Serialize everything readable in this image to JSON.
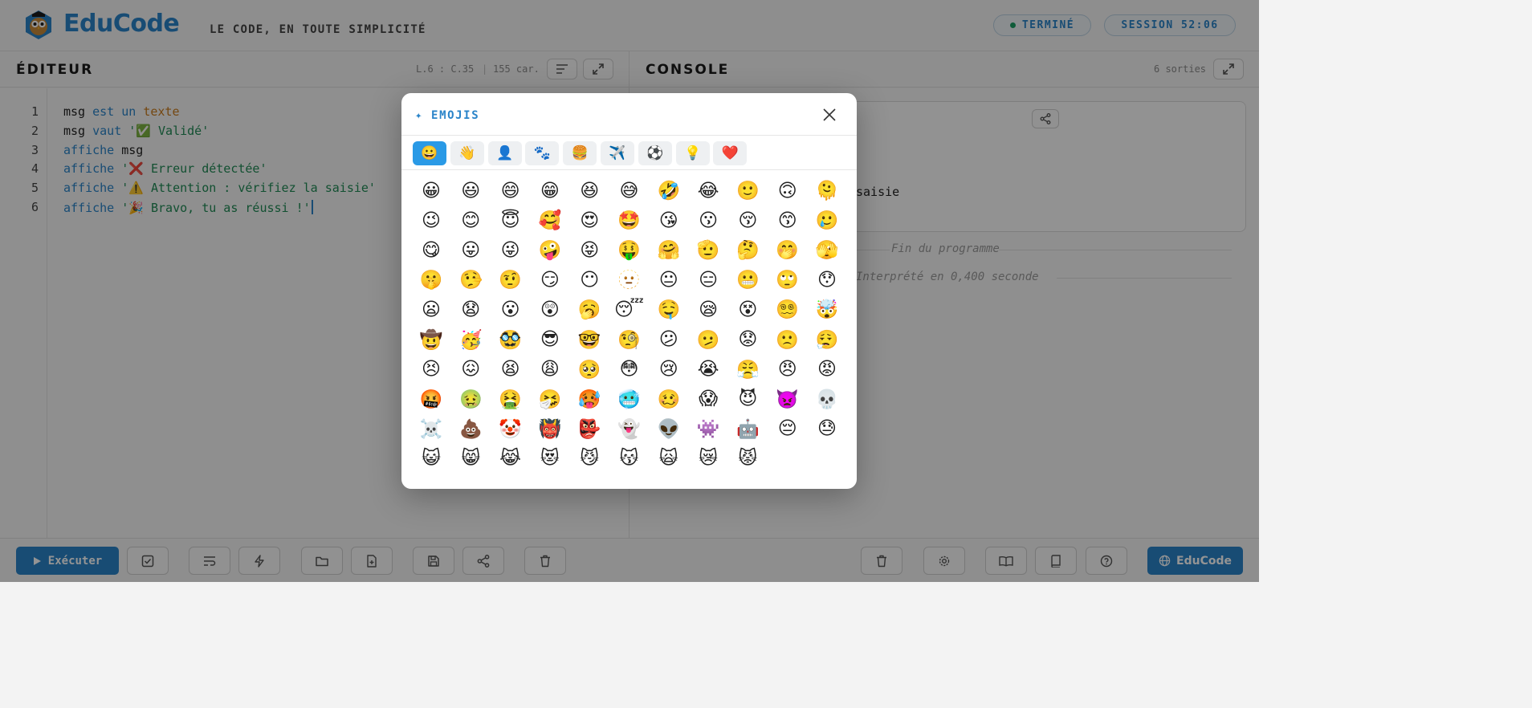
{
  "header": {
    "brand": "EduCode",
    "tagline": "LE CODE, EN TOUTE SIMPLICITÉ",
    "status": "TERMINÉ",
    "session": "SESSION 52:06"
  },
  "editor": {
    "title": "ÉDITEUR",
    "position": "L.6 : C.35",
    "sep": "|",
    "chars": "155 car.",
    "line_numbers": [
      "1",
      "2",
      "3",
      "4",
      "5",
      "6"
    ],
    "lines": [
      [
        {
          "t": "msg ",
          "c": ""
        },
        {
          "t": "est un ",
          "c": "kw"
        },
        {
          "t": "texte",
          "c": "ty"
        }
      ],
      [
        {
          "t": "msg ",
          "c": ""
        },
        {
          "t": "vaut ",
          "c": "kw"
        },
        {
          "t": "'✅ Validé'",
          "c": "str"
        }
      ],
      [
        {
          "t": "affiche ",
          "c": "kw"
        },
        {
          "t": "msg",
          "c": ""
        }
      ],
      [
        {
          "t": "affiche ",
          "c": "kw"
        },
        {
          "t": "'❌ Erreur détectée'",
          "c": "str"
        }
      ],
      [
        {
          "t": "affiche ",
          "c": "kw"
        },
        {
          "t": "'⚠️ Attention : vérifiez la saisie'",
          "c": "str"
        }
      ],
      [
        {
          "t": "affiche ",
          "c": "kw"
        },
        {
          "t": "'🎉 Bravo, tu as réussi !'",
          "c": "str"
        }
      ]
    ]
  },
  "console": {
    "title": "CONSOLE",
    "count": "6 sorties",
    "output_fragment": "saisie",
    "end_text": "Fin du programme",
    "time_text": "Interprété en 0,400 seconde"
  },
  "footer": {
    "run_label": "Exécuter",
    "brand_label": "EduCode"
  },
  "modal": {
    "title": "✦ EMOJIS",
    "categories": [
      "😀",
      "👋",
      "👤",
      "🐾",
      "🍔",
      "✈️",
      "⚽",
      "💡",
      "❤️"
    ],
    "emojis": [
      "😀",
      "😃",
      "😄",
      "😁",
      "😆",
      "😅",
      "🤣",
      "😂",
      "🙂",
      "🙃",
      "🫠",
      "😉",
      "😊",
      "😇",
      "🥰",
      "😍",
      "🤩",
      "😘",
      "😗",
      "😚",
      "😙",
      "🥲",
      "😋",
      "😛",
      "😜",
      "🤪",
      "😝",
      "🤑",
      "🤗",
      "🫡",
      "🤔",
      "🤭",
      "🫣",
      "🤫",
      "🤥",
      "🤨",
      "😏",
      "😶",
      "🫥",
      "😐",
      "😑",
      "😬",
      "🙄",
      "😯",
      "😦",
      "😧",
      "😮",
      "😲",
      "🥱",
      "😴",
      "🤤",
      "😪",
      "😵",
      "😵‍💫",
      "🤯",
      "🤠",
      "🥳",
      "🥸",
      "😎",
      "🤓",
      "🧐",
      "😕",
      "🫤",
      "😟",
      "🙁",
      "😮‍💨",
      "😣",
      "😖",
      "😫",
      "😩",
      "🥺",
      "😳",
      "😢",
      "😭",
      "😤",
      "😠",
      "😡",
      "🤬",
      "🤢",
      "🤮",
      "🤧",
      "🥵",
      "🥶",
      "🥴",
      "😱",
      "😈",
      "👿",
      "💀",
      "☠️",
      "💩",
      "🤡",
      "👹",
      "👺",
      "👻",
      "👽",
      "👾",
      "🤖",
      "😔",
      "😓",
      "😺",
      "😸",
      "😹",
      "😻",
      "😼",
      "😽",
      "🙀",
      "😿",
      "😾"
    ]
  }
}
